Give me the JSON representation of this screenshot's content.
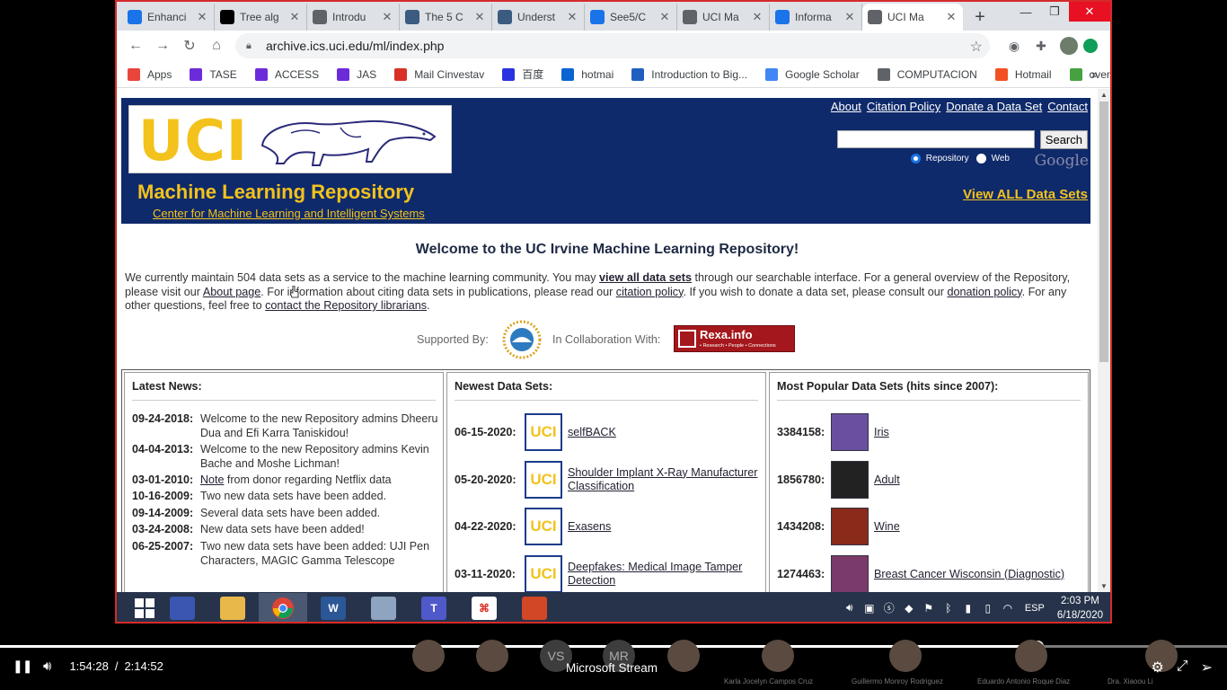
{
  "browser": {
    "tabs": [
      {
        "label": "Enhanci",
        "icon": "arrow-doc-icon",
        "color": "#1a73e8"
      },
      {
        "label": "Tree alg",
        "icon": "medium-icon",
        "color": "#000000"
      },
      {
        "label": "Introdu",
        "icon": "globe-icon",
        "color": "#5f6368"
      },
      {
        "label": "The 5 C",
        "icon": "tds-icon",
        "color": "#3b5b80"
      },
      {
        "label": "Underst",
        "icon": "tds-icon",
        "color": "#3b5b80"
      },
      {
        "label": "See5/C",
        "icon": "arrow-doc-icon",
        "color": "#1a73e8"
      },
      {
        "label": "UCI Ma",
        "icon": "globe-icon",
        "color": "#5f6368"
      },
      {
        "label": "Informa",
        "icon": "arrow-doc-icon",
        "color": "#1a73e8"
      },
      {
        "label": "UCI Ma",
        "icon": "globe-icon",
        "color": "#5f6368"
      }
    ],
    "url": "archive.ics.uci.edu/ml/index.php",
    "bookmarks": [
      {
        "label": "Apps",
        "color": "#e8453c"
      },
      {
        "label": "TASE",
        "color": "#6c2bd9"
      },
      {
        "label": "ACCESS",
        "color": "#6c2bd9"
      },
      {
        "label": "JAS",
        "color": "#6c2bd9"
      },
      {
        "label": "Mail Cinvestav",
        "color": "#d93025"
      },
      {
        "label": "百度",
        "color": "#2932e1"
      },
      {
        "label": "hotmai",
        "color": "#0a64d2"
      },
      {
        "label": "Introduction to Big...",
        "color": "#1f5fbf"
      },
      {
        "label": "Google Scholar",
        "color": "#4285f4"
      },
      {
        "label": "COMPUTACION",
        "color": "#5f6368"
      },
      {
        "label": "Hotmail",
        "color": "#f25022"
      },
      {
        "label": "overleaf",
        "color": "#47a141"
      }
    ],
    "bookmarks_more": "»"
  },
  "site": {
    "logo_text": "UCI",
    "title": "Machine Learning Repository",
    "subtitle": "Center for Machine Learning and Intelligent Systems",
    "top_links": [
      "About",
      "Citation Policy",
      "Donate a Data Set",
      "Contact"
    ],
    "search_button": "Search",
    "search_value": "",
    "radio_repository": "Repository",
    "radio_web": "Web",
    "google": "Google",
    "view_all": "View ALL Data Sets",
    "welcome": "Welcome to the UC Irvine Machine Learning Repository!",
    "intro": {
      "p1": "We currently maintain 504 data sets as a service to the machine learning community. You may ",
      "link1": "view all data sets",
      "p2": " through our searchable interface. For a general overview of the Repository, please visit our ",
      "link2": "About page",
      "p3": ". For information about citing data sets in publications, please read our ",
      "link3": "citation policy",
      "p4": ". If you wish to donate a data set, please consult our ",
      "link4": "donation policy",
      "p5": ". For any other questions, feel free to ",
      "link5": "contact the Repository librarians",
      "p6": "."
    },
    "supported_by": "Supported By:",
    "collab": "In Collaboration With:",
    "rexa_title": "Rexa.info",
    "rexa_sub": "• Research • People • Connections",
    "news_heading": "Latest News:",
    "news": [
      {
        "date": "09-24-2018:",
        "text": "Welcome to the new Repository admins Dheeru Dua and Efi Karra Taniskidou!"
      },
      {
        "date": "04-04-2013:",
        "text": "Welcome to the new Repository admins Kevin Bache and Moshe Lichman!"
      },
      {
        "date": "03-01-2010:",
        "link": "Note",
        "text": " from donor regarding Netflix data"
      },
      {
        "date": "10-16-2009:",
        "text": "Two new data sets have been added."
      },
      {
        "date": "09-14-2009:",
        "text": "Several data sets have been added."
      },
      {
        "date": "03-24-2008:",
        "text": "New data sets have been added!"
      },
      {
        "date": "06-25-2007:",
        "text": "Two new data sets have been added: UJI Pen Characters, MAGIC Gamma Telescope"
      }
    ],
    "newest_heading": "Newest Data Sets:",
    "newest": [
      {
        "date": "06-15-2020:",
        "name": "selfBACK"
      },
      {
        "date": "05-20-2020:",
        "name": "Shoulder Implant X-Ray Manufacturer Classification"
      },
      {
        "date": "04-22-2020:",
        "name": "Exasens"
      },
      {
        "date": "03-11-2020:",
        "name": "Deepfakes: Medical Image Tamper Detection"
      }
    ],
    "popular_heading": "Most Popular Data Sets (hits since 2007):",
    "popular": [
      {
        "hits": "3384158:",
        "name": "Iris",
        "color": "#6a4fa0"
      },
      {
        "hits": "1856780:",
        "name": "Adult",
        "color": "#222222"
      },
      {
        "hits": "1434208:",
        "name": "Wine",
        "color": "#8a2a1a"
      },
      {
        "hits": "1274463:",
        "name": "Breast Cancer Wisconsin (Diagnostic)",
        "color": "#7a3a6a"
      }
    ]
  },
  "taskbar": {
    "time": "2:03 PM",
    "date": "6/18/2020",
    "lang": "ESP",
    "apps": [
      {
        "name": "windows-start",
        "label": ""
      },
      {
        "name": "remote-desktop",
        "label": ""
      },
      {
        "name": "file-explorer",
        "label": ""
      },
      {
        "name": "chrome",
        "label": ""
      },
      {
        "name": "word",
        "label": "W"
      },
      {
        "name": "calculator",
        "label": ""
      },
      {
        "name": "teams",
        "label": "T"
      },
      {
        "name": "acrobat",
        "label": ""
      },
      {
        "name": "powerpoint",
        "label": ""
      }
    ]
  },
  "player": {
    "current_time": "1:54:28",
    "separator": "/",
    "total_time": "2:14:52",
    "app_name": "Microsoft Stream",
    "progress": 0.8453,
    "participants": [
      {
        "initials": "",
        "name": ""
      },
      {
        "initials": "",
        "name": ""
      },
      {
        "initials": "VS",
        "name": ""
      },
      {
        "initials": "MR",
        "name": ""
      },
      {
        "initials": "",
        "name": ""
      },
      {
        "initials": "",
        "name": "Karla Jocelyn Campos Cruz"
      },
      {
        "initials": "",
        "name": "Guillermo Monroy Rodriguez"
      },
      {
        "initials": "",
        "name": "Eduardo Antonio Roque Diaz"
      },
      {
        "initials": "",
        "name": "Dra. Xiaoou Li"
      }
    ]
  }
}
